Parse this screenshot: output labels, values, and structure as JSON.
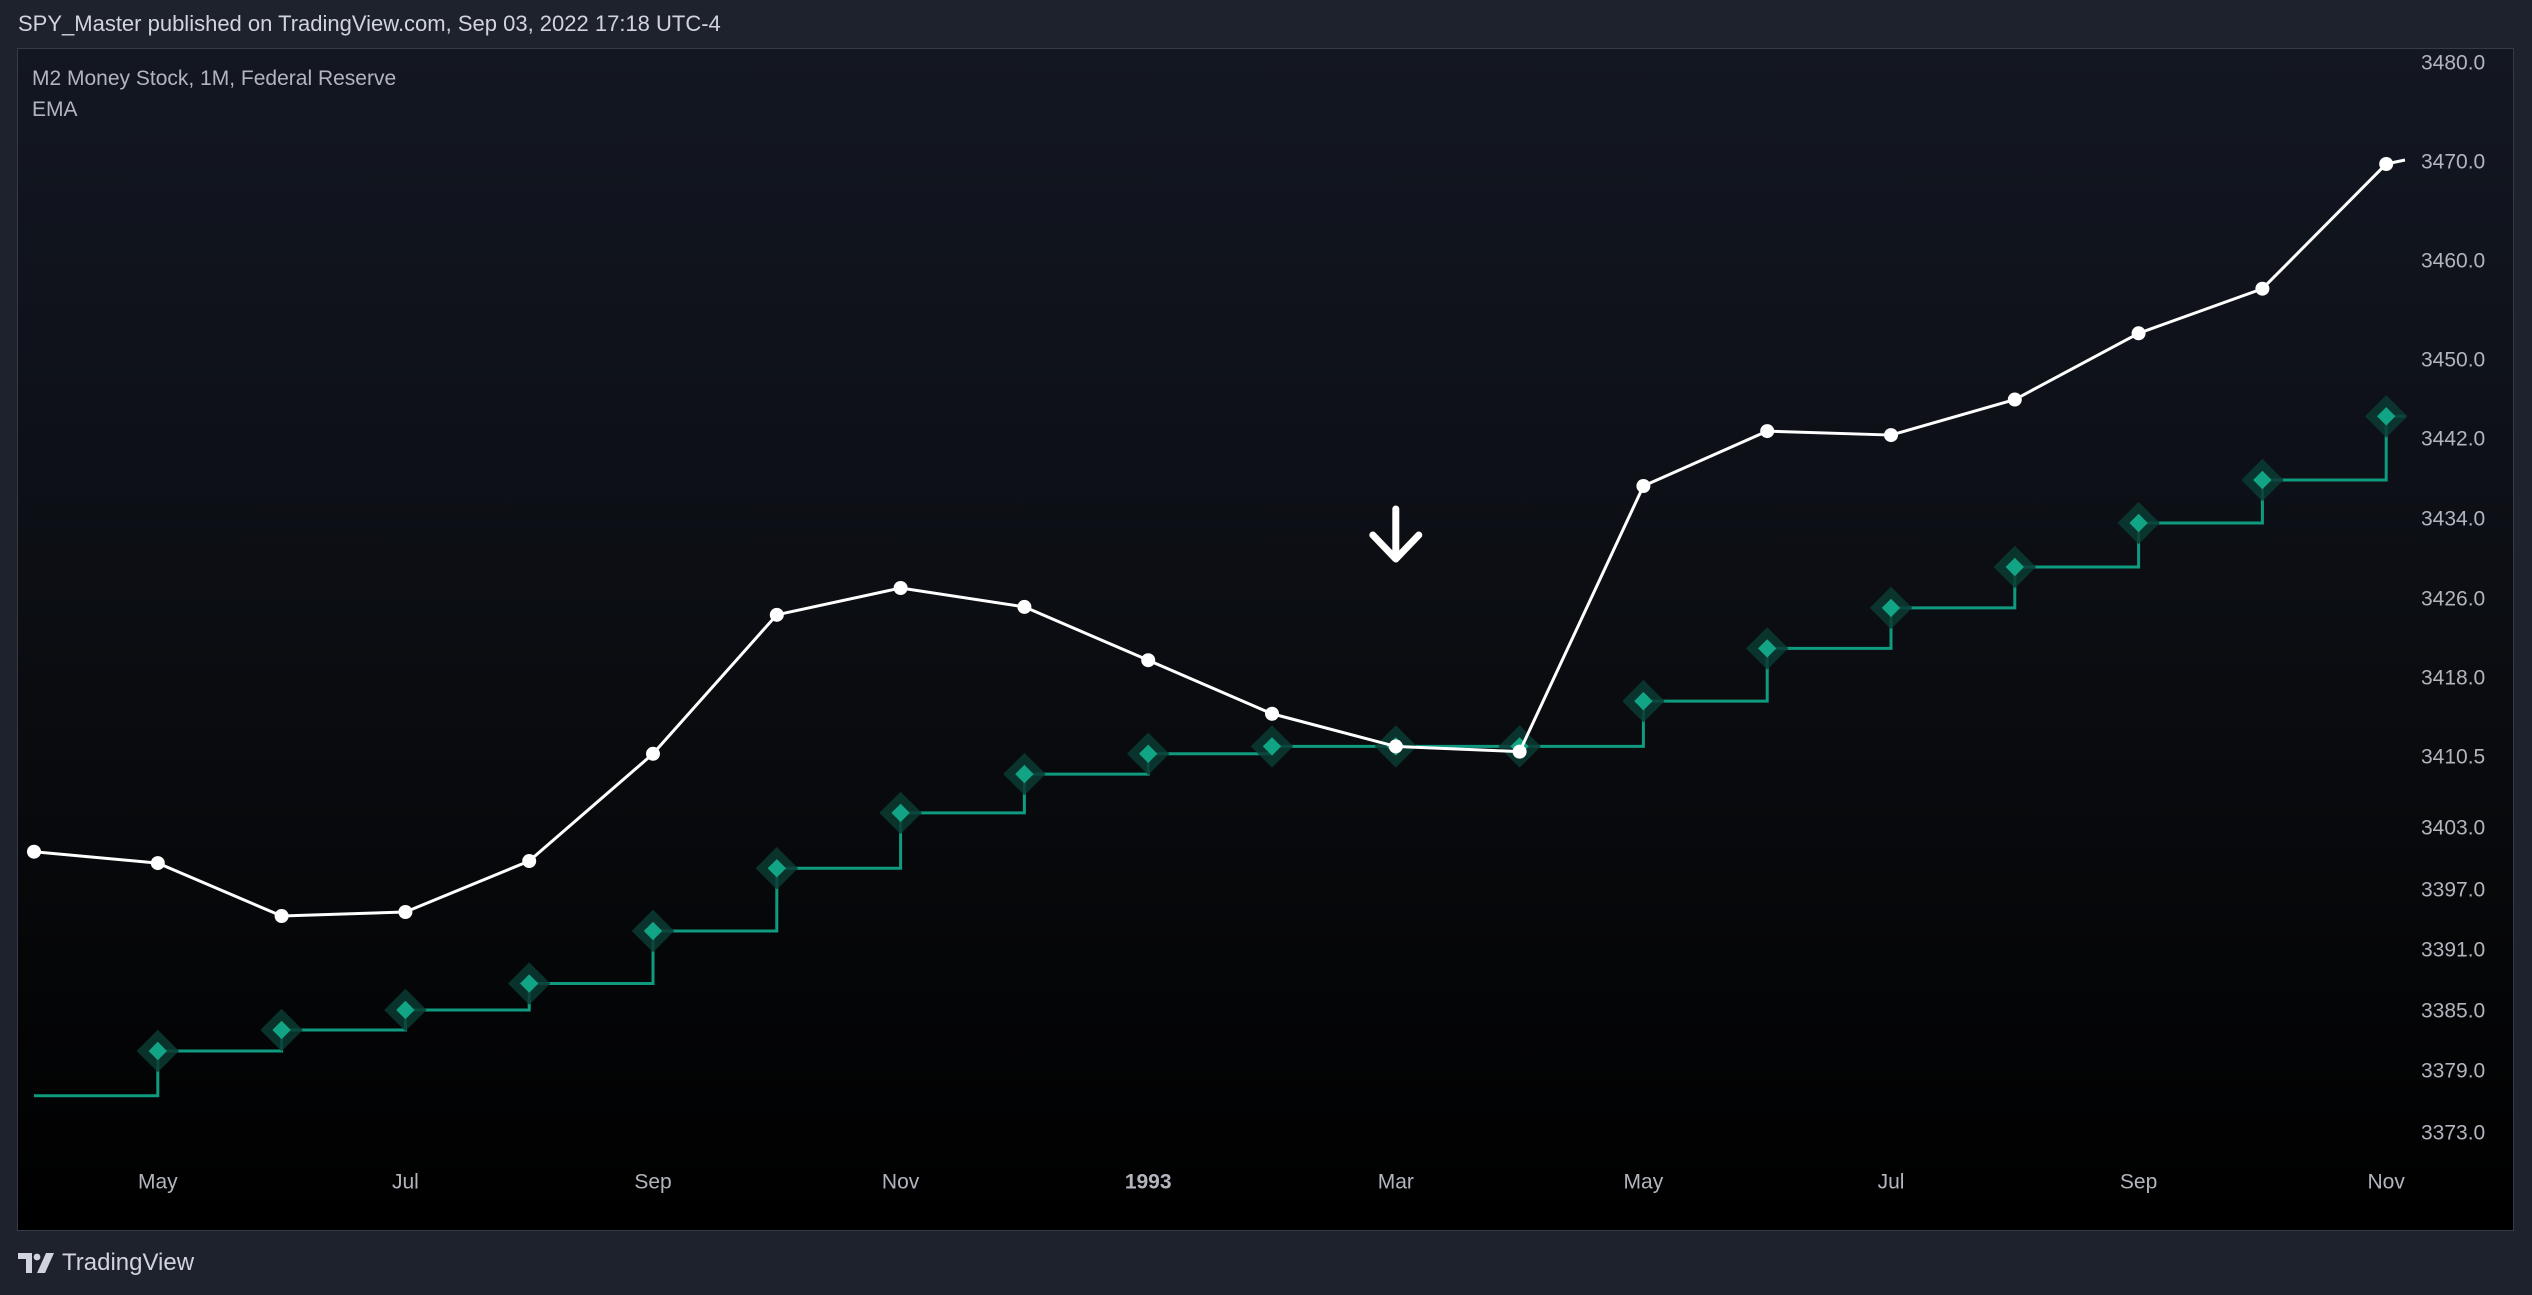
{
  "header": {
    "published_text": "SPY_Master published on TradingView.com, Sep 03, 2022 17:18 UTC-4"
  },
  "legend": {
    "series_title": "M2 Money Stock, 1M, Federal Reserve",
    "indicator_title": "EMA"
  },
  "footer": {
    "brand": "TradingView"
  },
  "colors": {
    "m2_line": "#ffffff",
    "ema_line": "#0f9b7f",
    "ema_marker": "#12a585",
    "ema_marker_halo": "#0b3b33",
    "axis_text": "#b2b5be",
    "annotation_arrow": "#ffffff"
  },
  "chart_data": {
    "type": "line",
    "title": "M2 Money Stock, 1M, Federal Reserve",
    "x": [
      "1992-04",
      "1992-05",
      "1992-06",
      "1992-07",
      "1992-08",
      "1992-09",
      "1992-10",
      "1992-11",
      "1992-12",
      "1993-01",
      "1993-02",
      "1993-03",
      "1993-04",
      "1993-05",
      "1993-06",
      "1993-07",
      "1993-08",
      "1993-09",
      "1993-10",
      "1993-11"
    ],
    "series": [
      {
        "values": [
          3400.8,
          3399.7,
          3394.5,
          3394.9,
          3399.9,
          3410.9,
          3424.5,
          3427.2,
          3425.3,
          3419.9,
          3414.7,
          3411.6,
          3411.1,
          3437.4,
          3442.9,
          3442.5,
          3446.1,
          3452.8,
          3457.3,
          3469.9
        ],
        "style": "line-with-dots"
      },
      {
        "name": "EMA",
        "values": [
          3376.7,
          3381.1,
          3383.2,
          3385.2,
          3387.8,
          3393.0,
          3399.2,
          3404.7,
          3408.8,
          3410.9,
          3411.6,
          3411.6,
          3411.6,
          3415.9,
          3421.1,
          3425.2,
          3429.3,
          3433.7,
          3438.0,
          3444.4
        ],
        "style": "step-with-diamonds"
      }
    ],
    "y_ticks": [
      "3480.0",
      "3470.0",
      "3460.0",
      "3450.0",
      "3442.0",
      "3434.0",
      "3426.0",
      "3418.0",
      "3410.5",
      "3403.0",
      "3397.0",
      "3391.0",
      "3385.0",
      "3379.0",
      "3373.0"
    ],
    "x_ticks": [
      {
        "label": "May",
        "month": "1992-05",
        "bold": false
      },
      {
        "label": "Jul",
        "month": "1992-07",
        "bold": false
      },
      {
        "label": "Sep",
        "month": "1992-09",
        "bold": false
      },
      {
        "label": "Nov",
        "month": "1992-11",
        "bold": false
      },
      {
        "label": "1993",
        "month": "1993-01",
        "bold": true
      },
      {
        "label": "Mar",
        "month": "1993-03",
        "bold": false
      },
      {
        "label": "May",
        "month": "1993-05",
        "bold": false
      },
      {
        "label": "Jul",
        "month": "1993-07",
        "bold": false
      },
      {
        "label": "Sep",
        "month": "1993-09",
        "bold": false
      },
      {
        "label": "Nov",
        "month": "1993-11",
        "bold": false
      }
    ],
    "annotations": [
      {
        "type": "arrow-down",
        "month": "1993-03",
        "value": 3432.5
      }
    ],
    "grid": false,
    "legend": "top-left",
    "y_axis_position": "right"
  }
}
